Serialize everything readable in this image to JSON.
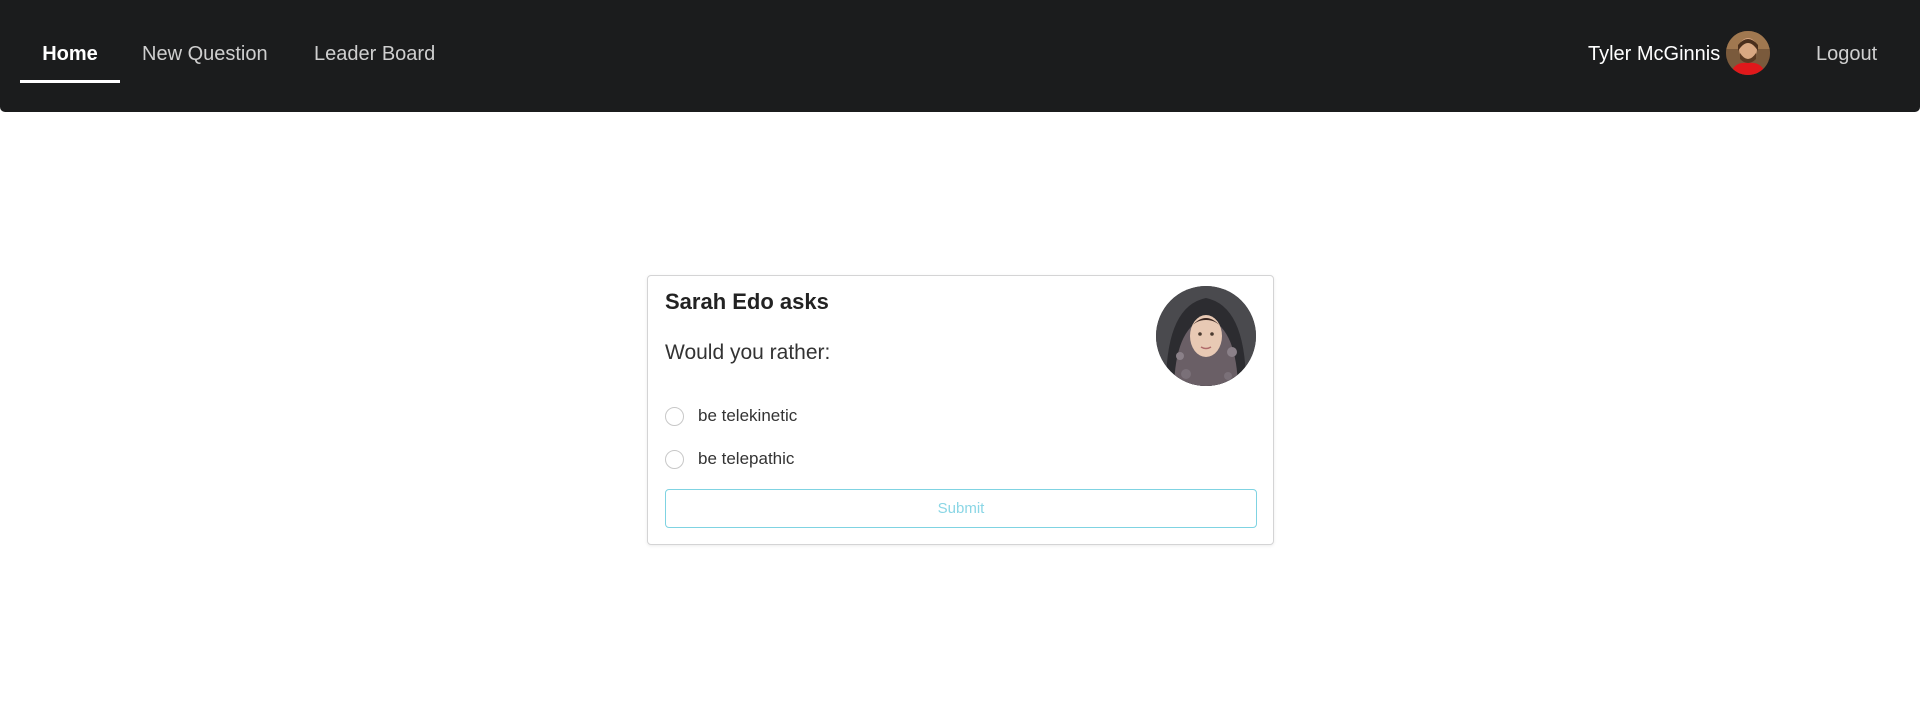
{
  "nav": {
    "items": [
      {
        "label": "Home",
        "active": true
      },
      {
        "label": "New Question",
        "active": false
      },
      {
        "label": "Leader Board",
        "active": false
      }
    ],
    "user_name": "Tyler McGinnis",
    "logout_label": "Logout"
  },
  "question": {
    "title": "Sarah Edo asks",
    "prompt": "Would you rather:",
    "options": [
      {
        "label": "be telekinetic"
      },
      {
        "label": "be telepathic"
      }
    ],
    "submit_label": "Submit"
  },
  "colors": {
    "navbar_bg": "#1b1c1d",
    "submit_accent": "#7fd3e2",
    "card_border": "#d4d4d5"
  },
  "icons": {
    "user_avatar": "user-avatar-photo",
    "asker_avatar": "asker-avatar-photo"
  }
}
